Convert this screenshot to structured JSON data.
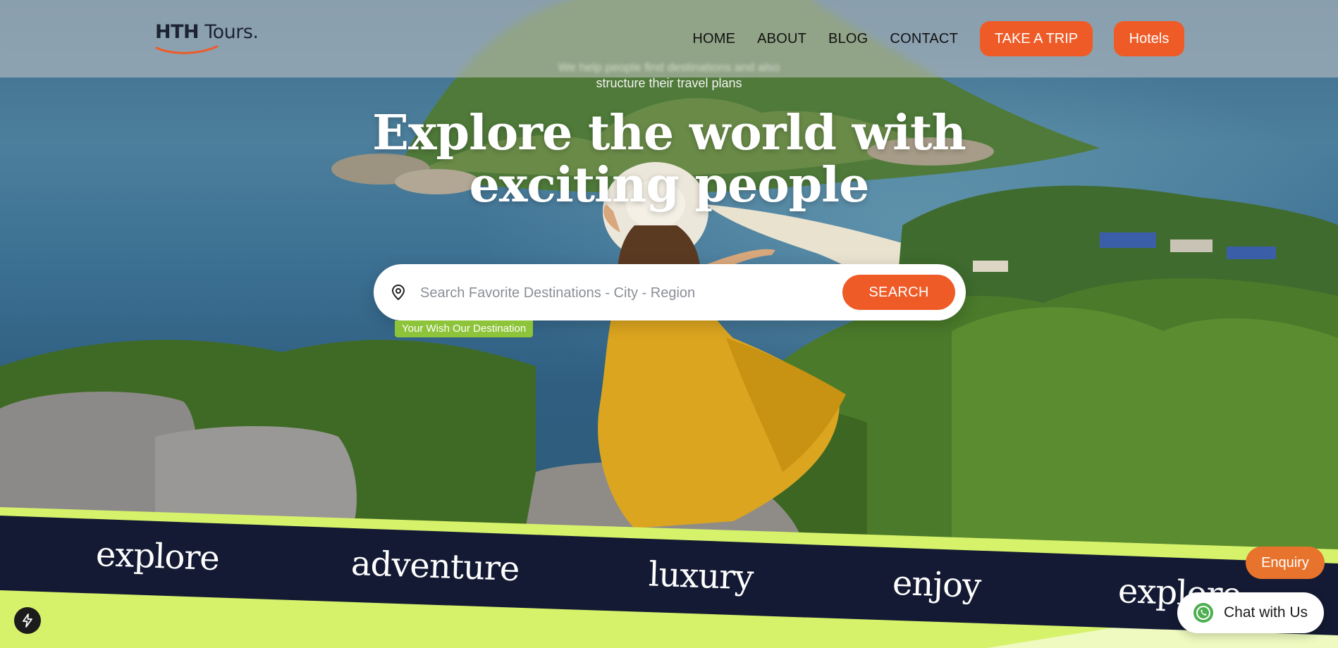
{
  "brand": {
    "logo_bold": "HTH",
    "logo_regular": " Tours."
  },
  "nav": {
    "items": [
      "HOME",
      "ABOUT",
      "BLOG",
      "CONTACT"
    ],
    "take_trip": "TAKE A TRIP",
    "hotels": "Hotels"
  },
  "hero": {
    "tagline_blurred": "We help people find destinations and also",
    "tagline": "structure their travel plans",
    "headline_line1": "Explore the world with",
    "headline_line2": "exciting people"
  },
  "search": {
    "placeholder": "Search Favorite Destinations - City - Region",
    "button": "SEARCH",
    "badge": "Your Wish Our Destination"
  },
  "band": {
    "words": [
      "explore",
      "adventure",
      "luxury",
      "enjoy",
      "explore"
    ]
  },
  "floating": {
    "enquiry": "Enquiry",
    "chat": "Chat with Us"
  },
  "colors": {
    "accent": "#ef5b27",
    "badge": "#8dc43a",
    "band": "#141a33",
    "lime": "#d6f26a"
  }
}
